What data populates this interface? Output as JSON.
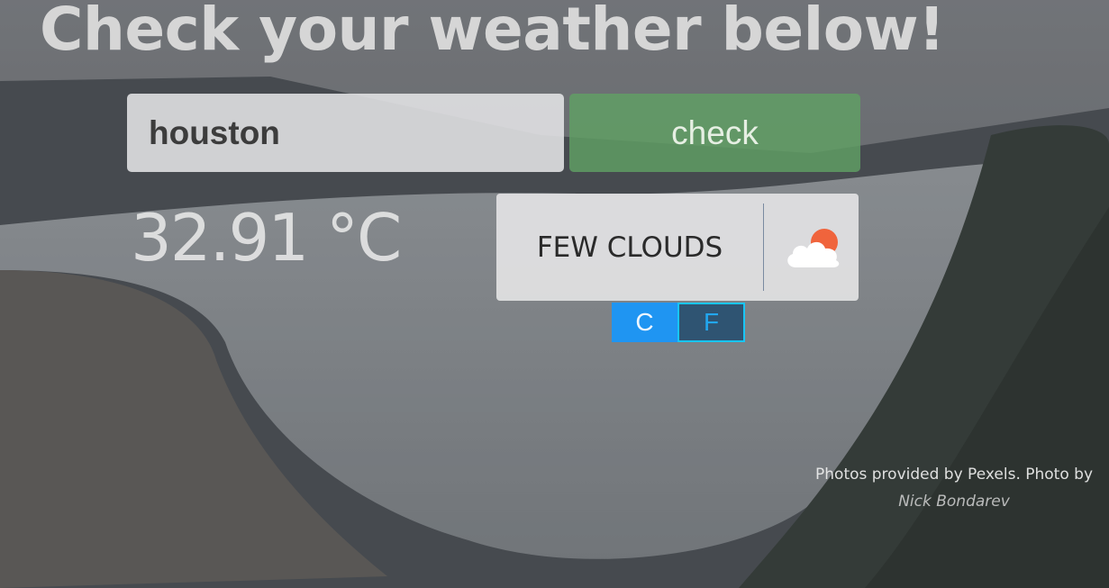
{
  "header": {
    "title": "Check your weather below!"
  },
  "search": {
    "value": "houston",
    "button_label": "check"
  },
  "weather": {
    "temperature": "32.91 °C",
    "condition": "FEW CLOUDS",
    "icon": "few-clouds-icon"
  },
  "units": {
    "celsius_label": "C",
    "fahrenheit_label": "F",
    "selected": "C"
  },
  "credit": {
    "text": "Photos provided by Pexels. Photo by",
    "author": "Nick Bondarev"
  },
  "colors": {
    "check_button": "#60a064",
    "unit_c": "#1f95f2",
    "unit_f_border": "#18c6f6",
    "sun": "#f0643c"
  }
}
